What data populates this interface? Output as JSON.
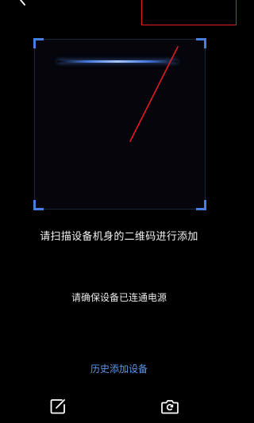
{
  "header": {
    "back_icon": "chevron-left-icon"
  },
  "scanner": {
    "frame_corner_color": "#4a7de0",
    "scan_line_color": "#7fa8ff",
    "prompt": "请扫描设备机身的二维码进行添加"
  },
  "hint": {
    "text": "请确保设备已连通电源"
  },
  "history": {
    "label": "历史添加设备",
    "color": "#5d97e6"
  },
  "toolbar": {
    "left_icon": "edit-icon",
    "right_icon": "camera-switch-icon"
  },
  "annotations": {
    "color": "#e41b23"
  }
}
